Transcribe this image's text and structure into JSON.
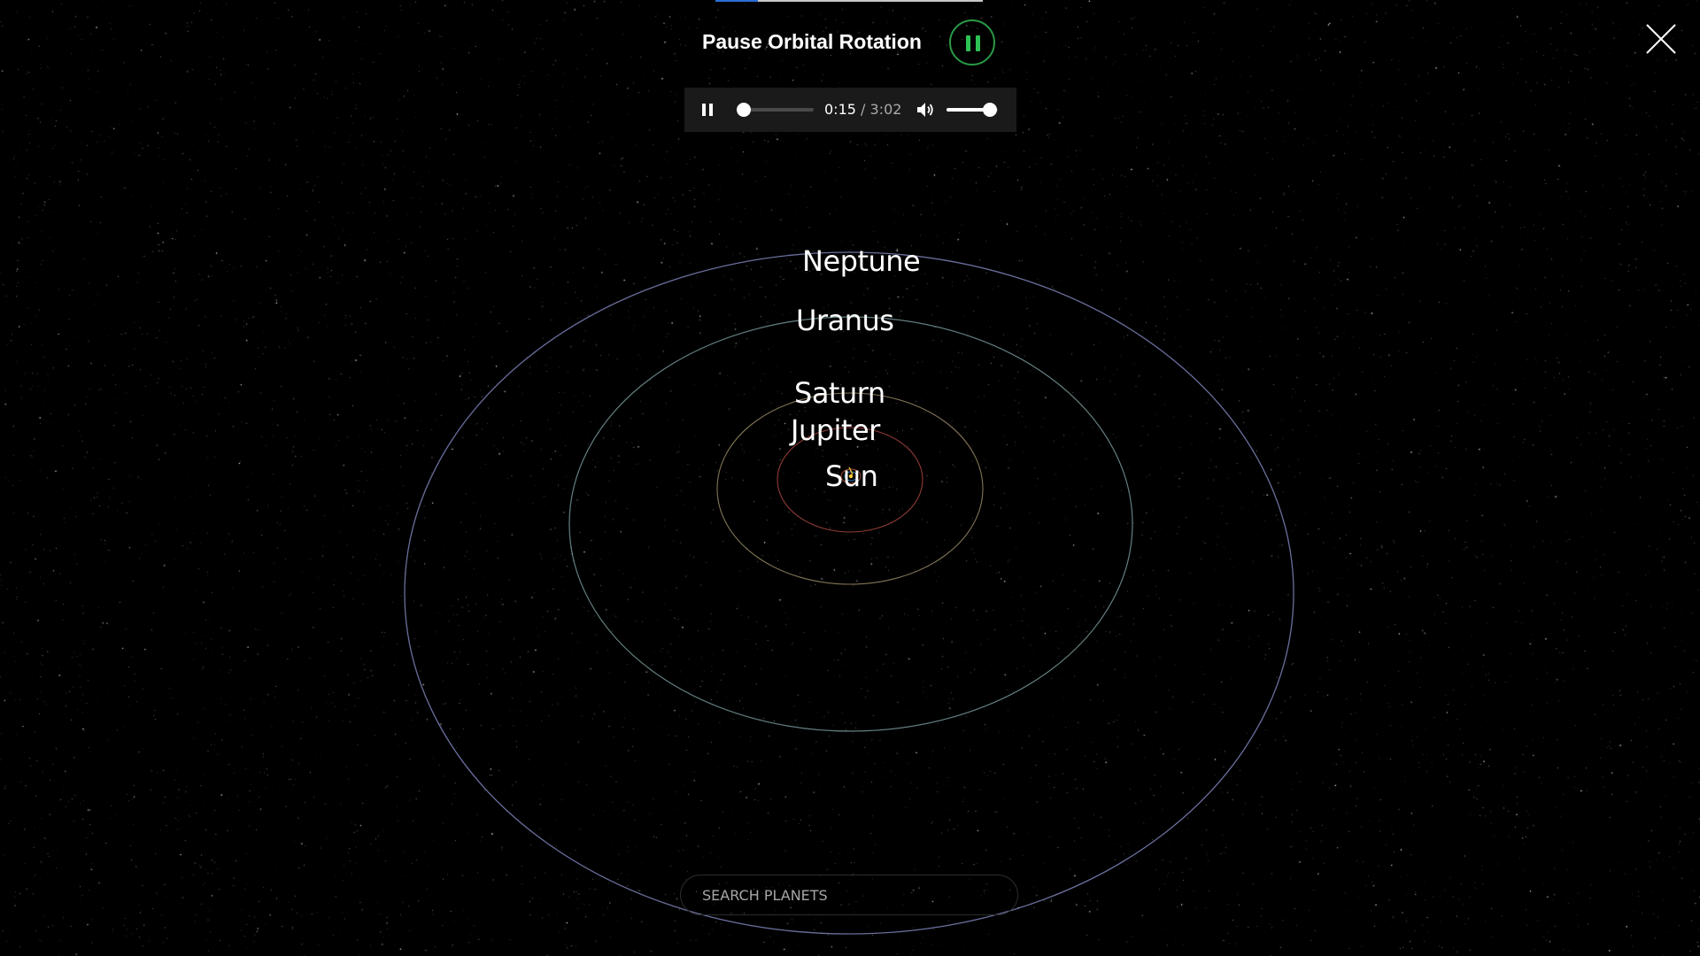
{
  "header": {
    "pause_label": "Pause Orbital Rotation",
    "pause_button_state": "playing",
    "top_progress": 0.16
  },
  "audio_player": {
    "current_time": "0:15",
    "separator": " / ",
    "duration": "3:02",
    "progress": 0.082,
    "volume": 0.85,
    "play_state": "playing"
  },
  "planets": {
    "neptune": "Neptune",
    "uranus": "Uranus",
    "saturn": "Saturn",
    "jupiter": "Jupiter",
    "sun": "Sun"
  },
  "search": {
    "placeholder": "SEARCH PLANETS",
    "value": ""
  },
  "icons": {
    "close": "close-icon",
    "pause": "pause-icon",
    "volume": "volume-icon"
  },
  "colors": {
    "accent_green": "#2ec255",
    "seek_blue": "#2a8ad8",
    "background": "#000000"
  }
}
